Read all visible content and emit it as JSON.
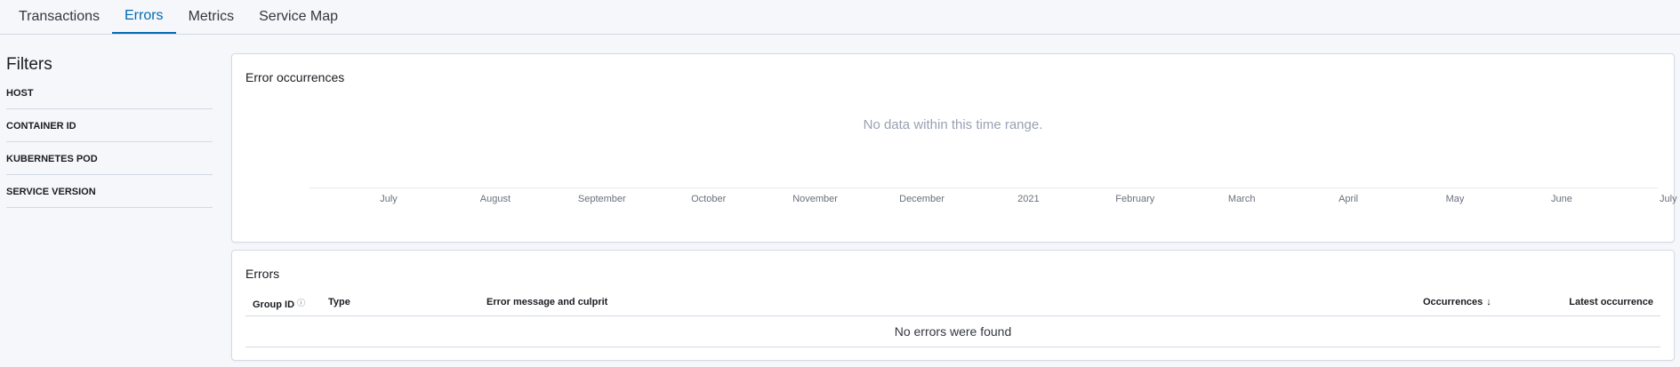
{
  "tabs": [
    {
      "label": "Transactions",
      "selected": false
    },
    {
      "label": "Errors",
      "selected": true
    },
    {
      "label": "Metrics",
      "selected": false
    },
    {
      "label": "Service Map",
      "selected": false
    }
  ],
  "filters": {
    "title": "Filters",
    "items": [
      "HOST",
      "CONTAINER ID",
      "KUBERNETES POD",
      "SERVICE VERSION"
    ]
  },
  "error_chart": {
    "title": "Error occurrences",
    "empty_message": "No data within this time range.",
    "x_ticks": [
      "July",
      "August",
      "September",
      "October",
      "November",
      "December",
      "2021",
      "February",
      "March",
      "April",
      "May",
      "June",
      "July"
    ]
  },
  "errors_table": {
    "title": "Errors",
    "columns": {
      "group_id": "Group ID",
      "type": "Type",
      "message": "Error message and culprit",
      "occurrences": "Occurrences",
      "latest": "Latest occurrence"
    },
    "sort_icon": "arrow-down-icon",
    "info_icon": "question-circle-icon",
    "empty_message": "No errors were found"
  },
  "colors": {
    "accent": "#006bb4",
    "border": "#d3dae6",
    "page_bg": "#f5f7fa",
    "muted_text": "#98a2b3"
  }
}
